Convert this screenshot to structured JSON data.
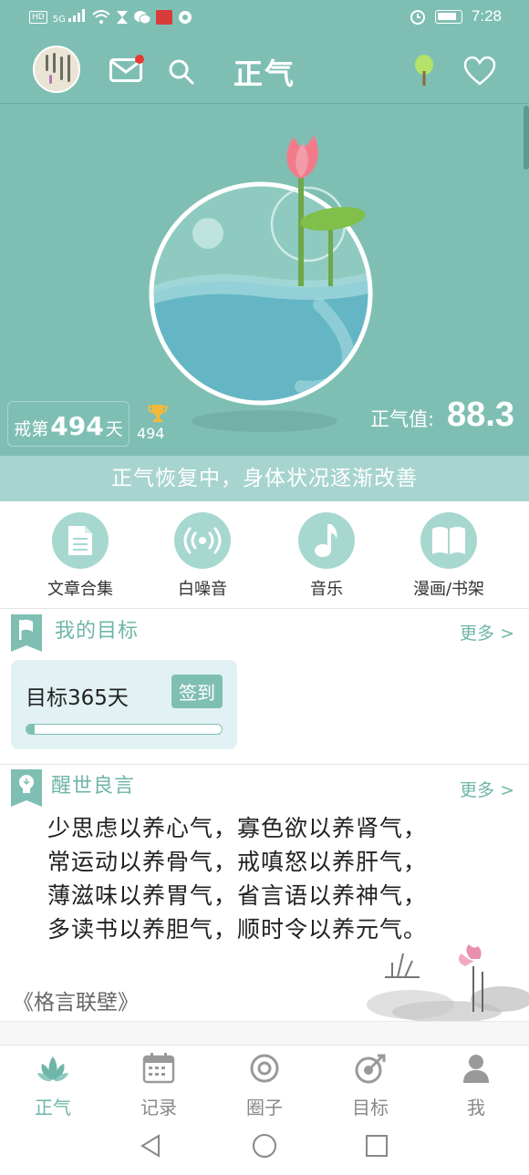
{
  "status_bar": {
    "network_badge": "HD",
    "signal_label": "5G",
    "time": "7:28"
  },
  "header": {
    "title": "正气",
    "icons": [
      "avatar",
      "mail-icon",
      "search-icon",
      "tree-icon",
      "heart-icon"
    ],
    "mail_unread": true
  },
  "hero": {
    "streak_prefix": "戒第",
    "streak_days": "494",
    "streak_suffix": "天",
    "trophy_count": "494",
    "energy_label": "正气值:",
    "energy_value": "88.3",
    "status_message": "正气恢复中，身体状况逐渐改善"
  },
  "actions": [
    {
      "label": "文章合集",
      "icon": "document-icon"
    },
    {
      "label": "白噪音",
      "icon": "broadcast-icon"
    },
    {
      "label": "音乐",
      "icon": "music-note-icon"
    },
    {
      "label": "漫画/书架",
      "icon": "book-icon"
    }
  ],
  "goals": {
    "title": "我的目标",
    "more": "更多 >",
    "card": {
      "name": "目标365天",
      "checkin_label": "签到",
      "progress": 0.04
    }
  },
  "sayings": {
    "title": "醒世良言",
    "more": "更多 >",
    "lines": [
      "少思虑以养心气，寡色欲以养肾气，",
      "常运动以养骨气，戒嗔怒以养肝气，",
      "薄滋味以养胃气，省言语以养神气，",
      "多读书以养胆气，顺时令以养元气。"
    ],
    "source": "《格言联壁》"
  },
  "tabs": [
    {
      "label": "正气",
      "icon": "lotus-icon",
      "active": true
    },
    {
      "label": "记录",
      "icon": "calendar-icon",
      "active": false
    },
    {
      "label": "圈子",
      "icon": "circle-icon",
      "active": false
    },
    {
      "label": "目标",
      "icon": "target-icon",
      "active": false
    },
    {
      "label": "我",
      "icon": "person-icon",
      "active": false
    }
  ],
  "colors": {
    "primary": "#7fbfb3",
    "primary_text": "#6fb5a8",
    "strip": "#a7d4ce",
    "action_circle": "#a7d8d0",
    "goal_card": "#e2f2f4",
    "unread_dot": "#e53935"
  }
}
